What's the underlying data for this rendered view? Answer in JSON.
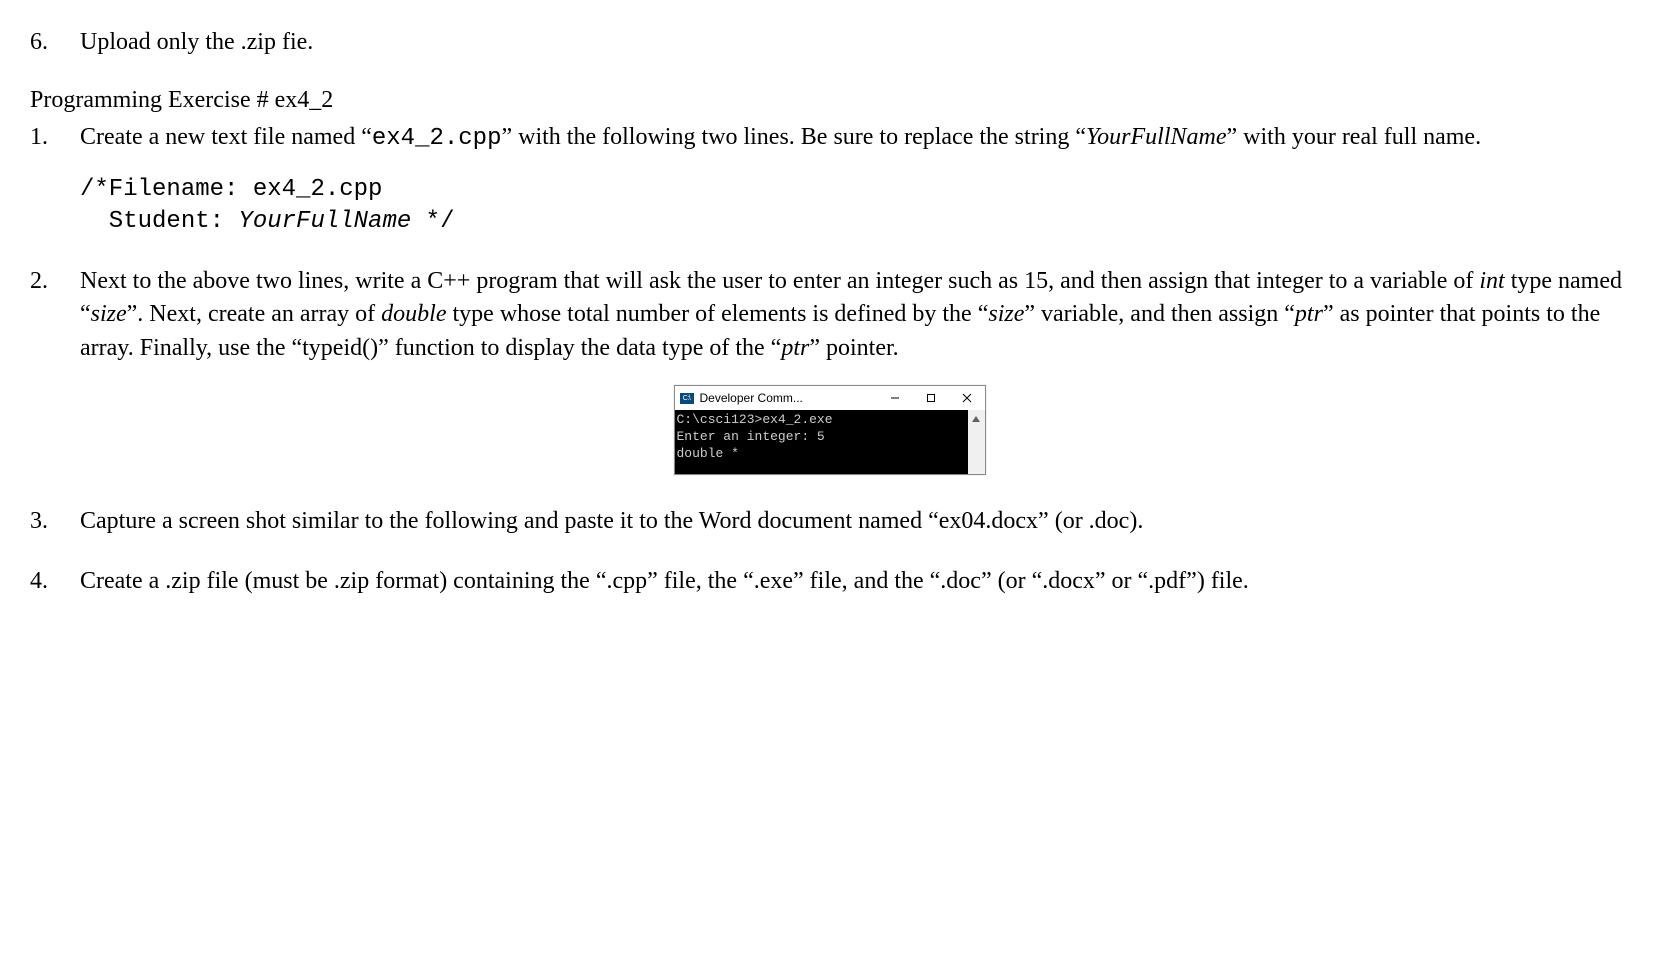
{
  "item6": {
    "num": "6.",
    "text": "Upload only the .zip fie."
  },
  "heading_ex4_2": "Programming Exercise # ex4_2",
  "ex4_2": {
    "step1": {
      "num": "1.",
      "pre": "Create a new text file named “",
      "filename": "ex4_2.cpp",
      "mid": "” with the following two lines. Be sure to replace the string “",
      "yourfullname": "YourFullName",
      "post": "” with your real full name."
    },
    "code": {
      "line1": "/*Filename: ex4_2.cpp",
      "line2_a": "  Student: ",
      "line2_b": "YourFullName",
      "line2_c": " */"
    },
    "step2": {
      "num": "2.",
      "t1": "Next to the above two lines, write a C++ program that will ask the user to enter an integer such as 15, and then assign that integer to a variable of ",
      "int_word": "int",
      "t2": " type named “",
      "size_word1": "size",
      "t3": "”. Next, create an array of ",
      "double_word": "double",
      "t4": " type whose total number of elements is defined by the “",
      "size_word2": "size",
      "t5": "” variable, and then assign “",
      "ptr_word1": "ptr",
      "t6": "” as pointer that points to the array. Finally, use the “typeid()” function to display the data type of the “",
      "ptr_word2": "ptr",
      "t7": "” pointer."
    },
    "console": {
      "title": "Developer Comm...",
      "icon_text": "C:\\",
      "line1": "C:\\csci123>ex4_2.exe",
      "line2": "Enter an integer: 5",
      "line3": "double *"
    },
    "step3": {
      "num": "3.",
      "text": "Capture a screen shot similar to the following and paste it to the Word document named “ex04.docx” (or .doc)."
    },
    "step4": {
      "num": "4.",
      "text": "Create a .zip file (must be .zip format) containing the “.cpp” file, the “.exe” file, and the “.doc” (or “.docx” or “.pdf”) file."
    }
  }
}
